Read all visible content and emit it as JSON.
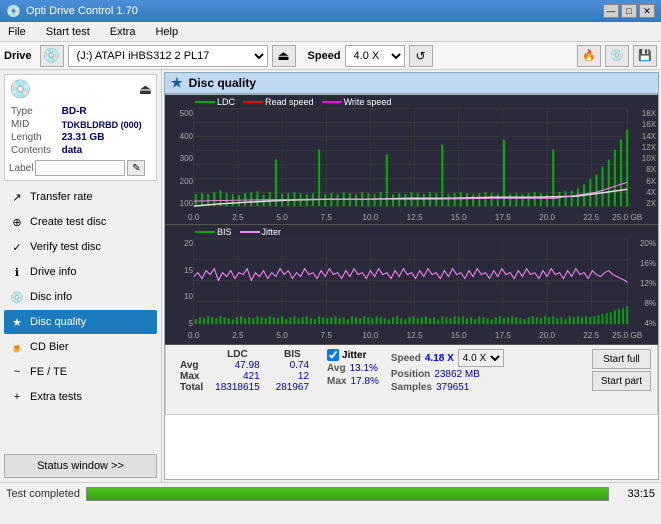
{
  "titleBar": {
    "title": "Opti Drive Control 1.70",
    "minimize": "—",
    "maximize": "□",
    "close": "✕"
  },
  "menu": {
    "items": [
      "File",
      "Start test",
      "Extra",
      "Help"
    ]
  },
  "toolbar": {
    "driveLabel": "Drive",
    "driveValue": "(J:)  ATAPI iHBS312  2 PL17",
    "speedLabel": "Speed",
    "speedValue": "4.0 X"
  },
  "sidebar": {
    "discType": "BD-R",
    "discMID": "TDKBLDRBD (000)",
    "discLength": "23.31 GB",
    "discContents": "data",
    "discLabel": "",
    "navItems": [
      {
        "id": "transfer-rate",
        "label": "Transfer rate",
        "icon": "↗"
      },
      {
        "id": "create-test-disc",
        "label": "Create test disc",
        "icon": "⊕"
      },
      {
        "id": "verify-test-disc",
        "label": "Verify test disc",
        "icon": "✓"
      },
      {
        "id": "drive-info",
        "label": "Drive info",
        "icon": "ℹ"
      },
      {
        "id": "disc-info",
        "label": "Disc info",
        "icon": "💿"
      },
      {
        "id": "disc-quality",
        "label": "Disc quality",
        "icon": "★",
        "active": true
      },
      {
        "id": "cd-bier",
        "label": "CD Bier",
        "icon": "🍺"
      },
      {
        "id": "fe-te",
        "label": "FE / TE",
        "icon": "~"
      },
      {
        "id": "extra-tests",
        "label": "Extra tests",
        "icon": "+"
      }
    ],
    "statusWindow": "Status window >>",
    "typeLabel": "Type",
    "midLabel": "MID",
    "lengthLabel": "Length",
    "contentsLabel": "Contents"
  },
  "chart": {
    "title": "Disc quality",
    "legend1": {
      "ldc": "LDC",
      "readSpeed": "Read speed",
      "writeSpeed": "Write speed"
    },
    "legend2": {
      "bis": "BIS",
      "jitter": "Jitter"
    },
    "upperYLabels": [
      "18X",
      "16X",
      "14X",
      "12X",
      "10X",
      "8X",
      "6X",
      "4X",
      "2X"
    ],
    "upperYLabelsLeft": [
      "500",
      "400",
      "300",
      "200",
      "100"
    ],
    "lowerYLabelsLeft": [
      "20",
      "15",
      "10",
      "5"
    ],
    "lowerYLabelsRight": [
      "20%",
      "16%",
      "12%",
      "8%",
      "4%"
    ],
    "xLabels": [
      "0.0",
      "2.5",
      "5.0",
      "7.5",
      "10.0",
      "12.5",
      "15.0",
      "17.5",
      "20.0",
      "22.5",
      "25.0 GB"
    ]
  },
  "stats": {
    "avgLabel": "Avg",
    "maxLabel": "Max",
    "totalLabel": "Total",
    "ldcAvg": "47.98",
    "ldcMax": "421",
    "ldcTotal": "18318615",
    "bisAvg": "0.74",
    "bisMax": "12",
    "bisTotal": "281967",
    "jitterLabel": "Jitter",
    "jitterAvg": "13.1%",
    "jitterMax": "17.8%",
    "jitterTotal": "",
    "speedLabel": "Speed",
    "speedValue": "4.18 X",
    "speedSelect": "4.0 X",
    "positionLabel": "Position",
    "positionValue": "23862 MB",
    "samplesLabel": "Samples",
    "samplesValue": "379651",
    "startFullLabel": "Start full",
    "startPartLabel": "Start part"
  },
  "bottomBar": {
    "statusText": "Test completed",
    "progressPct": 100,
    "time": "33:15"
  }
}
